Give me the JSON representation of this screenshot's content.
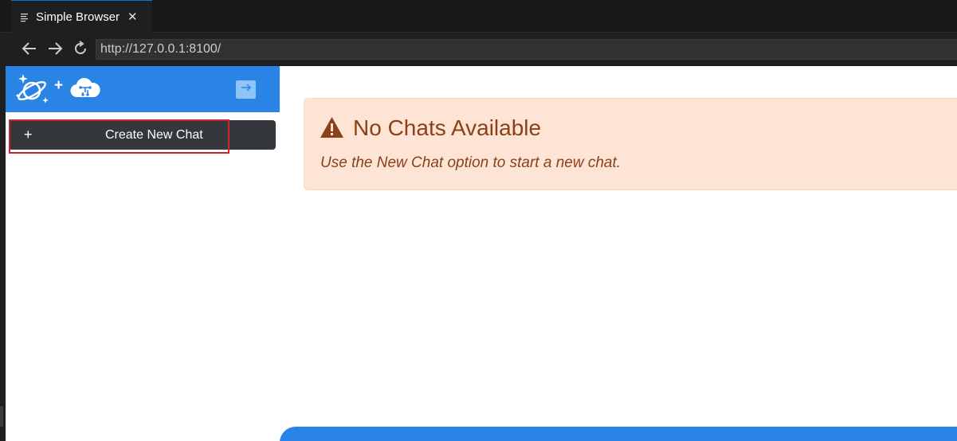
{
  "window": {
    "tab_title": "Simple Browser",
    "tab_icon": "file-icon",
    "close_icon": "close-icon"
  },
  "navigation": {
    "back_icon": "back-arrow-icon",
    "forward_icon": "forward-arrow-icon",
    "reload_icon": "reload-icon",
    "url": "http://127.0.0.1:8100/"
  },
  "sidebar": {
    "logo_icons": [
      "planet-sparkle-icon",
      "ai-cloud-icon"
    ],
    "logo_separator": "+",
    "collapse_icon": "arrow-right-icon",
    "new_chat": {
      "icon_text": "+",
      "label": "Create New Chat"
    }
  },
  "main": {
    "alert": {
      "icon": "warning-icon",
      "title": "No Chats Available",
      "message": "Use the New Chat option to start a new chat."
    }
  },
  "colors": {
    "accent": "#2a84e5",
    "alert_background": "#fde4d5",
    "alert_text": "#8a4118",
    "highlight_border": "#d1232a",
    "button_background": "#34373c"
  }
}
